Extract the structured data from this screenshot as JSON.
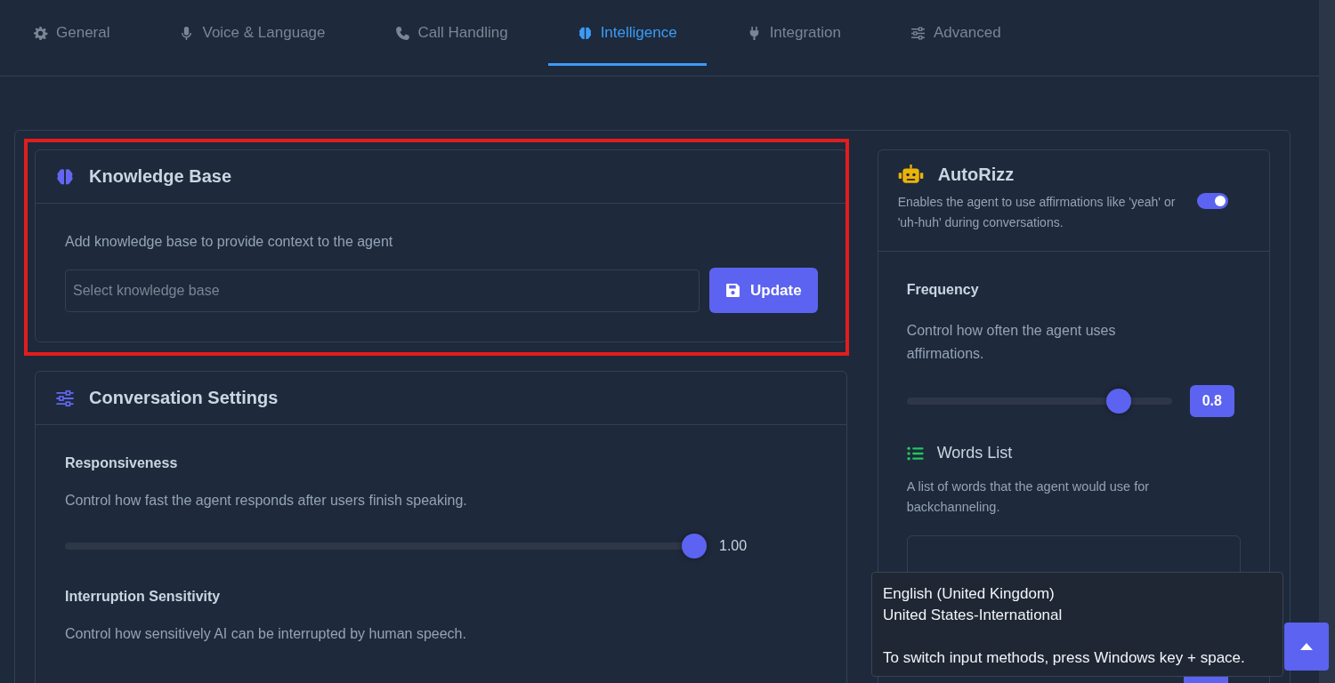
{
  "tabs": [
    {
      "label": "General",
      "selected": false
    },
    {
      "label": "Voice & Language",
      "selected": false
    },
    {
      "label": "Call Handling",
      "selected": false
    },
    {
      "label": "Intelligence",
      "selected": true
    },
    {
      "label": "Integration",
      "selected": false
    },
    {
      "label": "Advanced",
      "selected": false
    }
  ],
  "knowledge_base": {
    "title": "Knowledge Base",
    "highlighted": true,
    "description": "Add knowledge base to provide context to the agent",
    "placeholder": "Select knowledge base",
    "button": "Update"
  },
  "conversation_settings": {
    "title": "Conversation Settings",
    "settings": [
      {
        "label": "Responsiveness",
        "description": "Control how fast the agent responds after users finish speaking.",
        "level": 1.0,
        "reading": "1.00"
      },
      {
        "label": "Interruption Sensitivity",
        "description": "Control how sensitively AI can be interrupted by human speech."
      }
    ]
  },
  "autorizz": {
    "title": "AutoRizz",
    "description": "Enables the agent to use affirmations like 'yeah' or 'uh-huh' during conversations.",
    "on": true,
    "frequency": {
      "label": "Frequency",
      "description": "Control how often the agent uses affirmations.",
      "level": 0.8,
      "reading": "0.8"
    },
    "words_list": {
      "title": "Words List",
      "description": "A list of words that the agent would use for backchanneling."
    }
  },
  "tooltip": {
    "lines": [
      "English (United Kingdom)",
      "United States-International"
    ],
    "hint": "To switch input methods, press Windows key + space."
  }
}
